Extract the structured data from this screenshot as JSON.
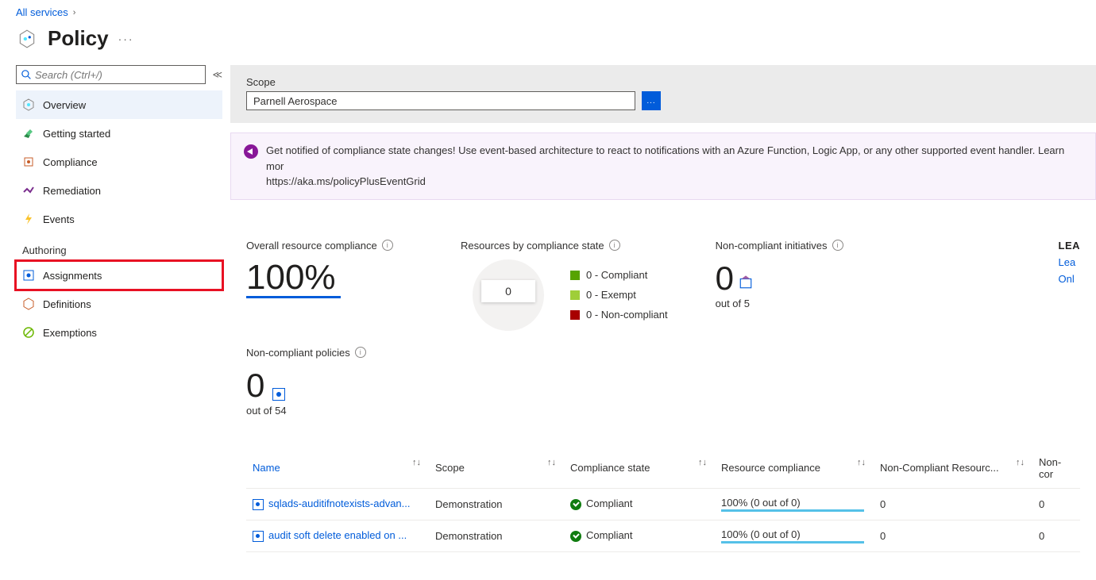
{
  "breadcrumb": {
    "all_services": "All services"
  },
  "page_title": "Policy",
  "sidebar": {
    "search_placeholder": "Search (Ctrl+/)",
    "items": {
      "overview": "Overview",
      "getting_started": "Getting started",
      "compliance": "Compliance",
      "remediation": "Remediation",
      "events": "Events"
    },
    "authoring_label": "Authoring",
    "authoring": {
      "assignments": "Assignments",
      "definitions": "Definitions",
      "exemptions": "Exemptions"
    }
  },
  "scope": {
    "label": "Scope",
    "value": "Parnell Aerospace",
    "button": "..."
  },
  "banner": {
    "text": "Get notified of compliance state changes! Use event-based architecture to react to notifications with an Azure Function, Logic App, or any other supported event handler. Learn mor",
    "link": "https://aka.ms/policyPlusEventGrid"
  },
  "stats": {
    "overall_title": "Overall resource compliance",
    "overall_value": "100%",
    "bystate_title": "Resources by compliance state",
    "donut_center": "0",
    "legend": {
      "compliant": "0 - Compliant",
      "exempt": "0 - Exempt",
      "noncompliant": "0 - Non-compliant"
    },
    "noncomp_init_title": "Non-compliant initiatives",
    "noncomp_init_value": "0",
    "noncomp_init_sub": "out of 5",
    "learn_heading": "LEA",
    "learn_link1": "Lea",
    "learn_link2": "Onl"
  },
  "noncomp_policies": {
    "title": "Non-compliant policies",
    "value": "0",
    "sub": "out of 54"
  },
  "table": {
    "headers": {
      "name": "Name",
      "scope": "Scope",
      "compliance_state": "Compliance state",
      "resource_compliance": "Resource compliance",
      "noncompliant_resources": "Non-Compliant Resourc...",
      "noncomp_last": "Non-cor"
    },
    "rows": [
      {
        "name": "sqlads-auditifnotexists-advan...",
        "scope": "Demonstration",
        "state": "Compliant",
        "resource": "100% (0 out of 0)",
        "ncr": "0",
        "last": "0"
      },
      {
        "name": "audit soft delete enabled on ...",
        "scope": "Demonstration",
        "state": "Compliant",
        "resource": "100% (0 out of 0)",
        "ncr": "0",
        "last": "0"
      }
    ]
  },
  "colors": {
    "compliant": "#57a300",
    "exempt": "#9fce39",
    "noncompliant": "#a80000"
  }
}
